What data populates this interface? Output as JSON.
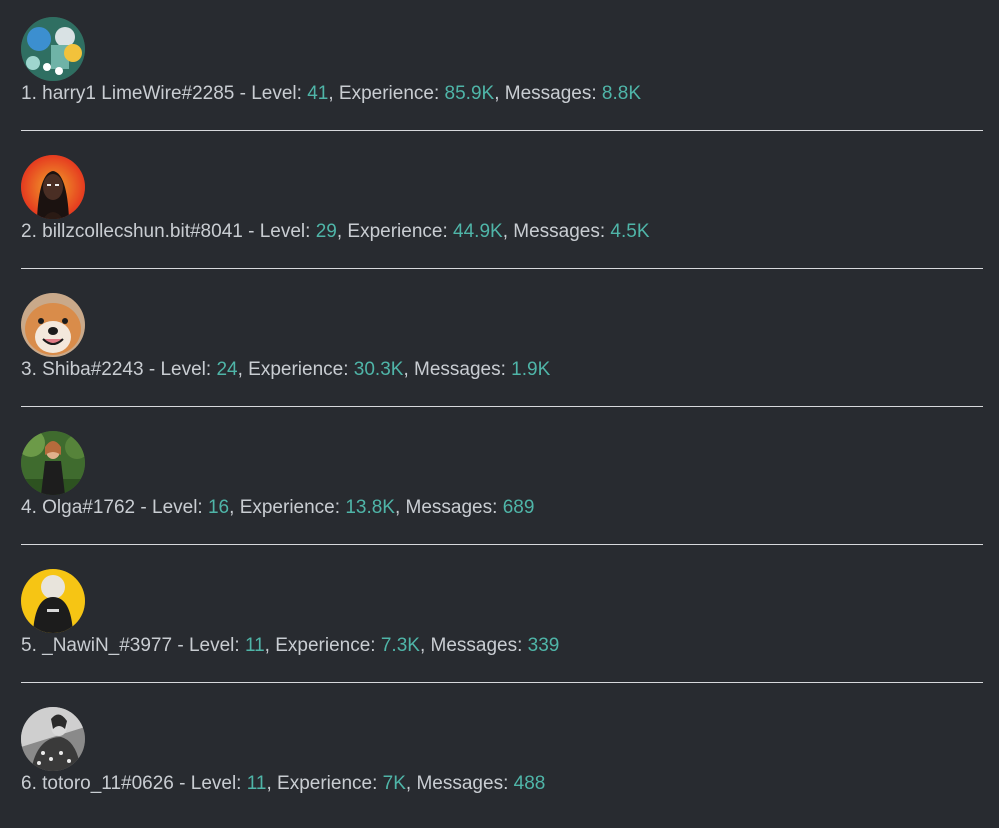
{
  "leaderboard": {
    "entries": [
      {
        "rank": "1.",
        "name": "harry1 LimeWire#2285",
        "level_label": "Level:",
        "level": "41",
        "xp_label": "Experience:",
        "xp": "85.9K",
        "msg_label": "Messages:",
        "messages": "8.8K",
        "avatar_icon": "avatar-harry1-icon"
      },
      {
        "rank": "2.",
        "name": "billzcollecshun.bit#8041",
        "level_label": "Level:",
        "level": "29",
        "xp_label": "Experience:",
        "xp": "44.9K",
        "msg_label": "Messages:",
        "messages": "4.5K",
        "avatar_icon": "avatar-billz-icon"
      },
      {
        "rank": "3.",
        "name": "Shiba#2243",
        "level_label": "Level:",
        "level": "24",
        "xp_label": "Experience:",
        "xp": "30.3K",
        "msg_label": "Messages:",
        "messages": "1.9K",
        "avatar_icon": "avatar-shiba-icon"
      },
      {
        "rank": "4.",
        "name": "Olga#1762",
        "level_label": "Level:",
        "level": "16",
        "xp_label": "Experience:",
        "xp": "13.8K",
        "msg_label": "Messages:",
        "messages": "689",
        "avatar_icon": "avatar-olga-icon"
      },
      {
        "rank": "5.",
        "name": "_NawiN_#3977",
        "level_label": "Level:",
        "level": "11",
        "xp_label": "Experience:",
        "xp": "7.3K",
        "msg_label": "Messages:",
        "messages": "339",
        "avatar_icon": "avatar-nawin-icon"
      },
      {
        "rank": "6.",
        "name": "totoro_11#0626",
        "level_label": "Level:",
        "level": "11",
        "xp_label": "Experience:",
        "xp": "7K",
        "msg_label": "Messages:",
        "messages": "488",
        "avatar_icon": "avatar-totoro-icon"
      }
    ]
  },
  "colors": {
    "background": "#282b30",
    "text": "#c9cdd2",
    "accent": "#4fb5a8",
    "divider": "#d7d9dc"
  }
}
